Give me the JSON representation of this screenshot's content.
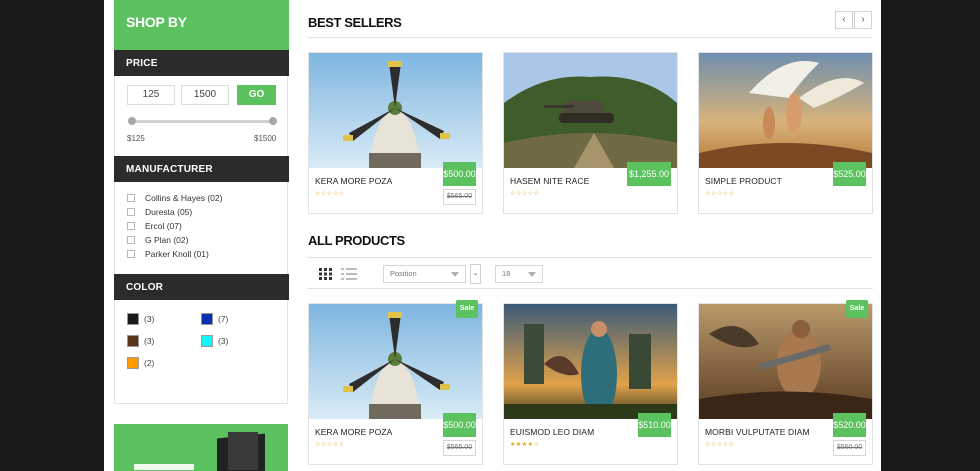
{
  "sidebar": {
    "shop_by": "SHOP BY",
    "price": {
      "heading": "PRICE",
      "min_value": "125",
      "max_value": "1500",
      "go_label": "GO",
      "min_label": "$125",
      "max_label": "$1500"
    },
    "manufacturer": {
      "heading": "MANUFACTURER",
      "items": [
        {
          "label": "Collins & Hayes (02)"
        },
        {
          "label": "Duresta (05)"
        },
        {
          "label": "Ercol (07)"
        },
        {
          "label": "G Plan (02)"
        },
        {
          "label": "Parker Knoll (01)"
        }
      ]
    },
    "color": {
      "heading": "COLOR",
      "items": [
        {
          "hex": "#1a1a1a",
          "count": "(3)"
        },
        {
          "hex": "#0a2fb0",
          "count": "(7)"
        },
        {
          "hex": "#5a3318",
          "count": "(3)"
        },
        {
          "hex": "#14f3f6",
          "count": "(3)"
        },
        {
          "hex": "#ff9a00",
          "count": "(2)"
        }
      ]
    }
  },
  "best_sellers": {
    "title": "BEST SELLERS",
    "prev_icon": "chevron-left-icon",
    "next_icon": "chevron-right-icon",
    "products": [
      {
        "name": "KERA MORE POZA",
        "price": "$500.00",
        "old_price": "$565.00",
        "rating": 0
      },
      {
        "name": "HASEM NITE RACE",
        "price": "$1,255.00",
        "old_price": "",
        "rating": 0
      },
      {
        "name": "SIMPLE PRODUCT",
        "price": "$525.00",
        "old_price": "",
        "rating": 0
      }
    ]
  },
  "all_products": {
    "title": "ALL PRODUCTS",
    "view_grid_icon": "grid-view-icon",
    "view_list_icon": "list-view-icon",
    "sort_select": "Position",
    "sort_dir_icon": "sort-direction-icon",
    "limit_select": "18",
    "sale_label": "Sale",
    "products": [
      {
        "name": "KERA MORE POZA",
        "price": "$500.00",
        "old_price": "$565.00",
        "rating": 0,
        "sale": true
      },
      {
        "name": "EUISMOD LEO DIAM",
        "price": "$510.00",
        "old_price": "",
        "rating": 4,
        "sale": false
      },
      {
        "name": "MORBI VULPUTATE DIAM",
        "price": "$520.00",
        "old_price": "$560.00",
        "rating": 0,
        "sale": true
      }
    ]
  },
  "colors": {
    "accent": "#5cc15f",
    "dark_header": "#2b2b2b",
    "background": "#1a1a1a"
  }
}
